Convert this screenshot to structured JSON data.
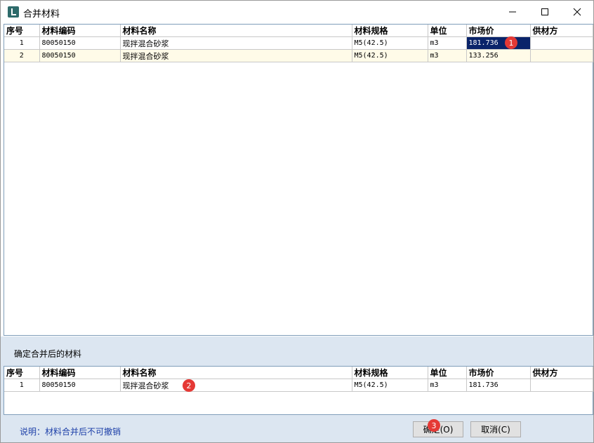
{
  "window": {
    "title": "合并材料"
  },
  "columns": [
    "序号",
    "材料编码",
    "材料名称",
    "材料规格",
    "单位",
    "市场价",
    "供材方"
  ],
  "top_rows": [
    {
      "idx": "1",
      "code": "80050150",
      "name": "现拌混合砂浆",
      "spec": "M5(42.5)",
      "unit": "m3",
      "price": "181.736",
      "supplier": ""
    },
    {
      "idx": "2",
      "code": "80050150",
      "name": "现拌混合砂浆",
      "spec": "M5(42.5)",
      "unit": "m3",
      "price": "133.256",
      "supplier": ""
    }
  ],
  "lower_label": "确定合并后的材料",
  "bottom_rows": [
    {
      "idx": "1",
      "code": "80050150",
      "name": "现拌混合砂浆",
      "spec": "M5(42.5)",
      "unit": "m3",
      "price": "181.736",
      "supplier": ""
    }
  ],
  "note": "说明：材料合并后不可撤销",
  "buttons": {
    "ok": "确定(O)",
    "cancel": "取消(C)"
  },
  "badges": [
    "1",
    "2",
    "3"
  ]
}
